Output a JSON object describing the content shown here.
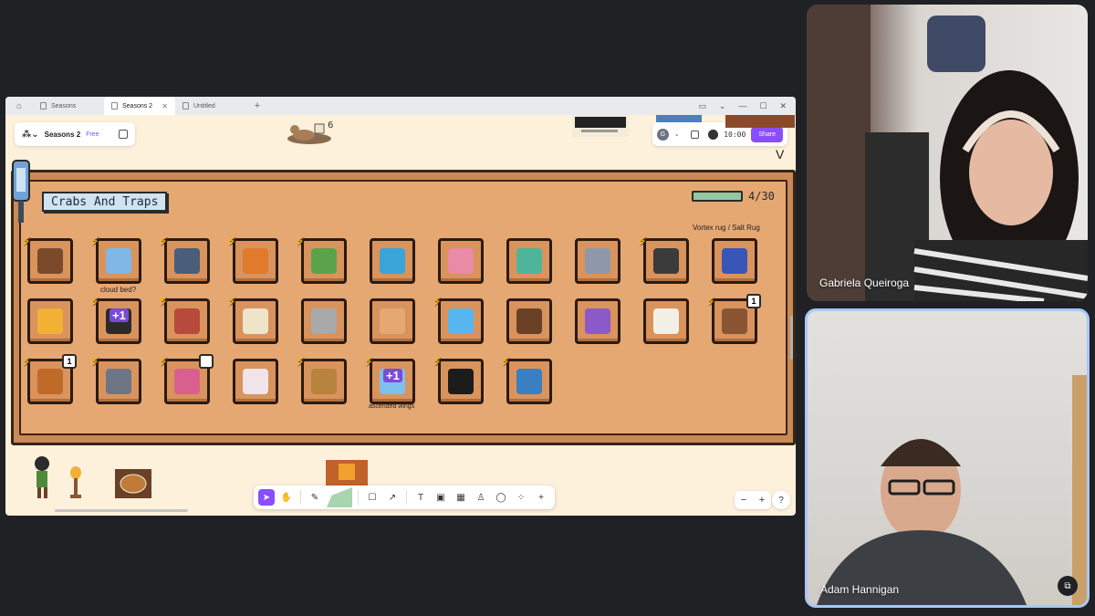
{
  "tabs": [
    {
      "label": "Seasons",
      "active": false
    },
    {
      "label": "Seasons 2",
      "active": true
    },
    {
      "label": "Untitled",
      "active": false
    }
  ],
  "doc": {
    "name": "Seasons 2",
    "plan": "Free"
  },
  "topbar": {
    "avatar_letter": "G",
    "timer": "10:00",
    "share_label": "Share"
  },
  "board": {
    "title": "Crabs And Traps",
    "progress": {
      "current": 4,
      "total": 30,
      "label": "4/30"
    },
    "notes": {
      "vortex": "Vortex rug / Salt Rug",
      "cloud": "cloud bed?",
      "wings": "ascended wings"
    }
  },
  "items_row1": [
    {
      "icon": "bear-fish-icon",
      "bolt": true,
      "color": "#7b4a2a"
    },
    {
      "icon": "ice-beast-icon",
      "bolt": true,
      "color": "#7fb8e6"
    },
    {
      "icon": "robot-helmet-icon",
      "bolt": true,
      "color": "#4a5d7a"
    },
    {
      "icon": "fox-fighter-icon",
      "bolt": true,
      "color": "#e07a2c"
    },
    {
      "icon": "flower-plant-icon",
      "bolt": true,
      "color": "#5aa34a"
    },
    {
      "icon": "blue-aquarium-icon",
      "bolt": false,
      "color": "#3ba4d9"
    },
    {
      "icon": "pink-aquarium-icon",
      "bolt": false,
      "color": "#e98aa6"
    },
    {
      "icon": "gator-aquarium-icon",
      "bolt": false,
      "color": "#4fb59a"
    },
    {
      "icon": "angel-knight-icon",
      "bolt": false,
      "color": "#8f98a8"
    },
    {
      "icon": "demon-beast-icon",
      "bolt": true,
      "color": "#3b3b3b"
    },
    {
      "icon": "vortex-rug-icon",
      "bolt": false,
      "color": "#3a55b8"
    }
  ],
  "items_row2": [
    {
      "icon": "golden-lamp-icon",
      "bolt": false,
      "color": "#f2b134"
    },
    {
      "icon": "dark-arch-icon",
      "bolt": true,
      "plus": "+1",
      "color": "#2b2b2b"
    },
    {
      "icon": "pixel-shrine-icon",
      "bolt": true,
      "color": "#b74a3c"
    },
    {
      "icon": "white-throne-icon",
      "bolt": true,
      "color": "#efe3c9"
    },
    {
      "icon": "gear-machine-icon",
      "bolt": false,
      "color": "#a9a9a9"
    },
    {
      "icon": "smile-box-icon",
      "bolt": false,
      "color": "#e5a873"
    },
    {
      "icon": "cloud-bed-icon",
      "bolt": true,
      "color": "#57b6ef"
    },
    {
      "icon": "mustache-chef-icon",
      "bolt": false,
      "color": "#6a4127"
    },
    {
      "icon": "purple-clock-icon",
      "bolt": false,
      "color": "#8c5ac8"
    },
    {
      "icon": "dalmatian-card-icon",
      "bolt": false,
      "color": "#f5f0e6"
    },
    {
      "icon": "wood-wall-icon",
      "bolt": true,
      "count": "1",
      "color": "#8a5532"
    }
  ],
  "items_row3": [
    {
      "icon": "pumpkin-pile-icon",
      "bolt": true,
      "count": "1",
      "color": "#c06a2a"
    },
    {
      "icon": "steel-wings-icon",
      "bolt": true,
      "color": "#6e7686"
    },
    {
      "icon": "flower-hat-icon",
      "bolt": true,
      "count": "",
      "color": "#d9608e"
    },
    {
      "icon": "white-ghost-icon",
      "bolt": false,
      "color": "#f1e4e8"
    },
    {
      "icon": "painted-face-icon",
      "bolt": true,
      "color": "#b8833c"
    },
    {
      "icon": "ascended-wings-icon",
      "bolt": true,
      "plus": "+1",
      "color": "#7cc0ef"
    },
    {
      "icon": "shadow-cloak-icon",
      "bolt": true,
      "color": "#1c1c1c"
    },
    {
      "icon": "blue-knight-icon",
      "bolt": true,
      "color": "#3a7fbf"
    }
  ],
  "participants": [
    {
      "name": "Gabriela Queiroga"
    },
    {
      "name": "Adam Hannigan"
    }
  ],
  "zoom": {
    "minus": "−",
    "plus": "+"
  },
  "help": "?"
}
